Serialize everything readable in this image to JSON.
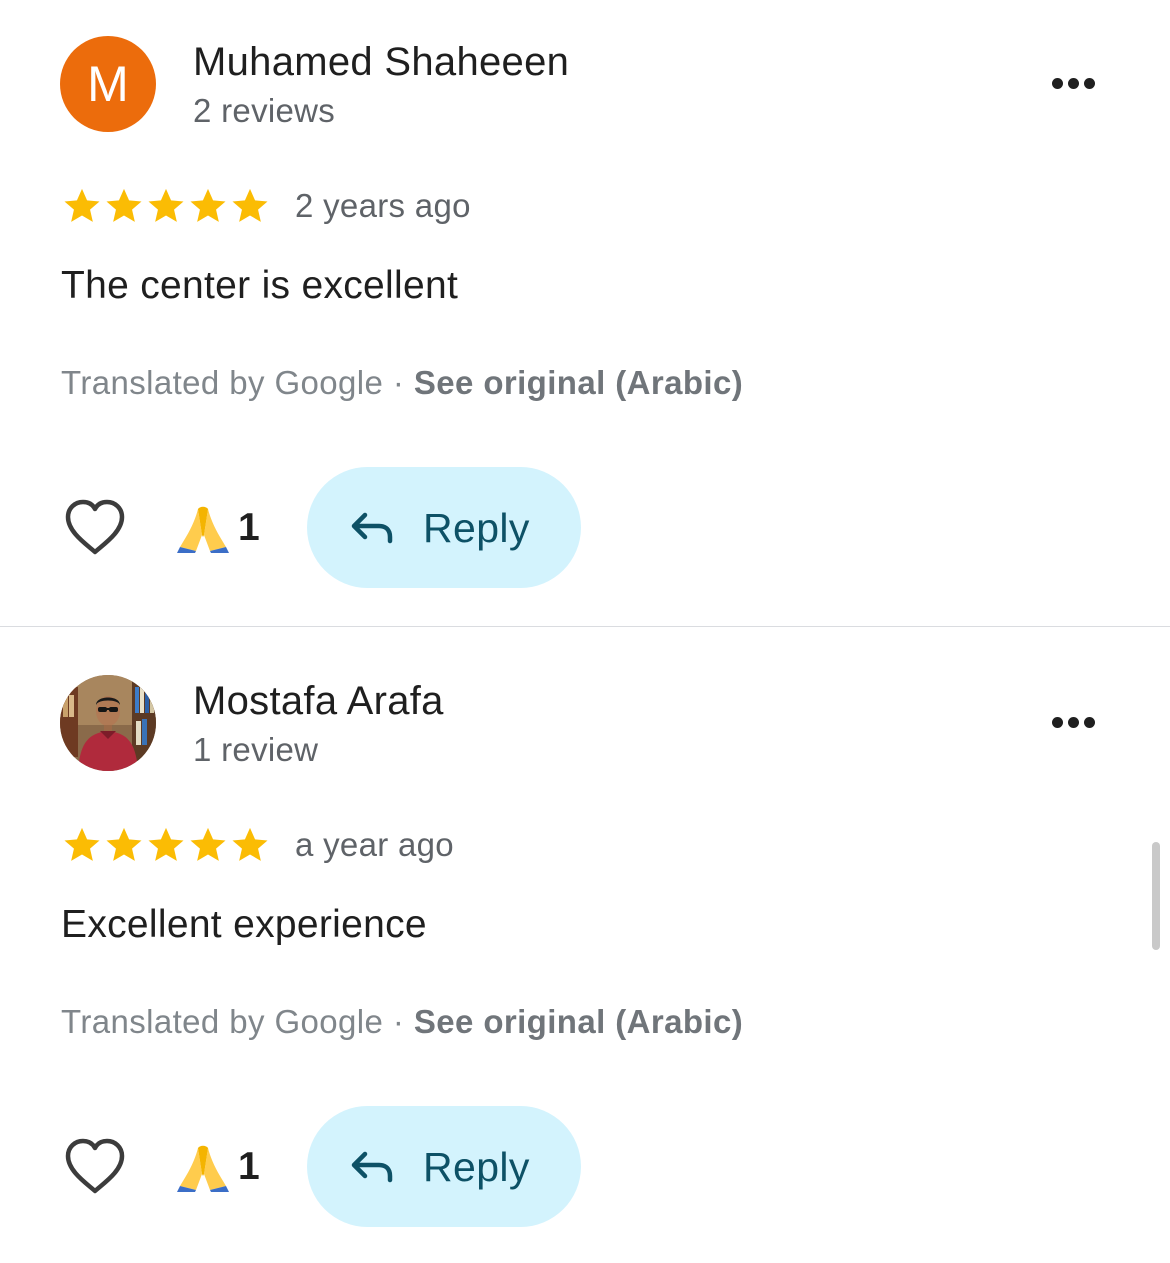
{
  "reviews": [
    {
      "author": "Muhamed Shaheeen",
      "author_meta": "2 reviews",
      "avatar_letter": "M",
      "avatar_color": "#ec6c0c",
      "rating": 5,
      "time": "2 years ago",
      "text": "The center is excellent",
      "translated_by": "Translated by Google · ",
      "see_original": "See original (Arabic)",
      "reaction_emoji": "folded-hands",
      "reaction_count": "1",
      "reply_label": "Reply"
    },
    {
      "author": "Mostafa Arafa",
      "author_meta": "1 review",
      "avatar_type": "photo",
      "rating": 5,
      "time": "a year ago",
      "text": "Excellent experience",
      "translated_by": "Translated by Google · ",
      "see_original": "See original (Arabic)",
      "reaction_emoji": "folded-hands",
      "reaction_count": "1",
      "reply_label": "Reply"
    }
  ],
  "colors": {
    "star": "#fbbc04",
    "reply_bg": "#d3f3fd",
    "reply_text": "#0d5166",
    "secondary_text": "#5f6368"
  }
}
